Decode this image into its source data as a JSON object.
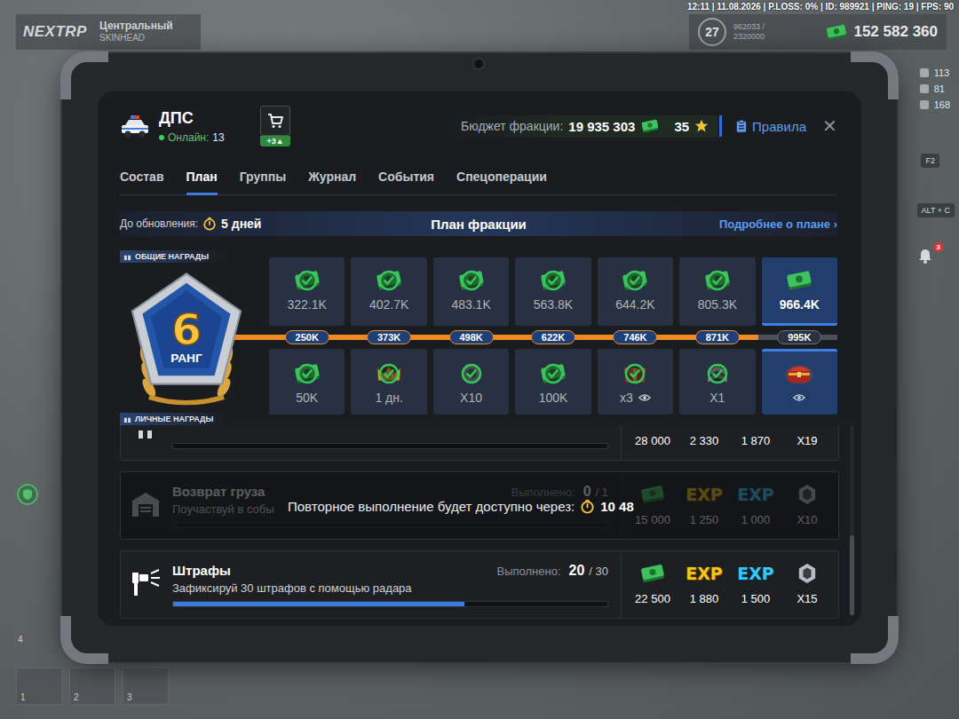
{
  "hud": {
    "status_line": "12:11 | 11.08.2026 | P.LOSS: 0% | ID: 989921 | PING: 19 | FPS: 90",
    "logo": "NEXTRP",
    "server": "Центральный",
    "player": "SKINHEAD",
    "level": "27",
    "xp": "962033 / 2320000",
    "money": "152 582 360",
    "stats": [
      "113",
      "81",
      "168"
    ],
    "hints": [
      "F2",
      "ALT + C"
    ],
    "notifications": "3",
    "hotbar": [
      "1",
      "2",
      "3"
    ],
    "extra_slot": "4"
  },
  "faction": {
    "name": "ДПС",
    "online_label": "Онлайн:",
    "online": "13",
    "shop_badge": "+3▲"
  },
  "budget": {
    "label": "Бюджет фракции:",
    "value": "19 935 303",
    "stars": "35"
  },
  "rules": "Правила",
  "close": "✕",
  "tabs": [
    {
      "label": "Состав",
      "selected": false
    },
    {
      "label": "План",
      "selected": true
    },
    {
      "label": "Группы",
      "selected": false
    },
    {
      "label": "Журнал",
      "selected": false
    },
    {
      "label": "События",
      "selected": false
    },
    {
      "label": "Спецоперации",
      "selected": false
    }
  ],
  "plan": {
    "update_label": "До обновления:",
    "update_time": "5 дней",
    "title": "План фракции",
    "more": "Подробнее о плане ›"
  },
  "rewards": {
    "common_label": "ОБЩИЕ НАГРАДЫ",
    "personal_label": "ЛИЧНЫЕ НАГРАДЫ",
    "rank": "6",
    "rank_label": "РАНГ",
    "track_level": 0.87,
    "tiers": [
      {
        "threshold": "250K",
        "reached": true,
        "current": false,
        "common": {
          "value": "322.1K",
          "claimed": true
        },
        "personal": {
          "kind": "money",
          "value": "50K",
          "claimed": true,
          "preview": false
        }
      },
      {
        "threshold": "373K",
        "reached": true,
        "current": false,
        "common": {
          "value": "402.7K",
          "claimed": true
        },
        "personal": {
          "kind": "crown",
          "value": "1 дн.",
          "claimed": true,
          "preview": false
        }
      },
      {
        "threshold": "498K",
        "reached": true,
        "current": false,
        "common": {
          "value": "483.1K",
          "claimed": true
        },
        "personal": {
          "kind": "badge",
          "value": "X10",
          "claimed": true,
          "preview": false
        }
      },
      {
        "threshold": "622K",
        "reached": true,
        "current": false,
        "common": {
          "value": "563.8K",
          "claimed": true
        },
        "personal": {
          "kind": "money",
          "value": "100K",
          "claimed": true,
          "preview": false
        }
      },
      {
        "threshold": "746K",
        "reached": true,
        "current": false,
        "common": {
          "value": "644.2K",
          "claimed": true
        },
        "personal": {
          "kind": "box",
          "value": "x3",
          "claimed": true,
          "preview": true
        }
      },
      {
        "threshold": "871K",
        "reached": true,
        "current": false,
        "common": {
          "value": "805.3K",
          "claimed": true
        },
        "personal": {
          "kind": "chevron",
          "value": "X1",
          "claimed": true,
          "preview": false
        }
      },
      {
        "threshold": "995K",
        "reached": false,
        "current": true,
        "common": {
          "value": "966.4K",
          "claimed": false
        },
        "personal": {
          "kind": "chest",
          "claimed": false,
          "preview": true
        }
      }
    ]
  },
  "tasks": [
    {
      "kind": "partial",
      "disabled": false,
      "level": 0,
      "rewards": [
        {
          "kind": "money",
          "value": "28 000"
        },
        {
          "kind": "exp",
          "value": "2 330"
        },
        {
          "kind": "exp2",
          "value": "1 870"
        },
        {
          "kind": "token",
          "value": "X19"
        }
      ]
    },
    {
      "kind": "cargo",
      "title": "Возврат груза",
      "description": "Поучаствуй в собы",
      "done_label": "Выполнено:",
      "done": "0",
      "total": "/ 1",
      "level": 0,
      "disabled": true,
      "cooldown": {
        "label": "Повторное выполнение будет доступно через:",
        "time": "10 48"
      },
      "rewards": [
        {
          "kind": "money",
          "value": "15 000"
        },
        {
          "kind": "exp",
          "label": "EXP",
          "value": "1 250"
        },
        {
          "kind": "exp2",
          "label": "EXP",
          "value": "1 000"
        },
        {
          "kind": "token",
          "value": "X10"
        }
      ]
    },
    {
      "kind": "radar",
      "title": "Штрафы",
      "description": "Зафиксируй 30 штрафов с помощью радара",
      "done_label": "Выполнено:",
      "done": "20",
      "total": "/ 30",
      "level": 0.67,
      "disabled": false,
      "rewards": [
        {
          "kind": "money",
          "value": "22 500"
        },
        {
          "kind": "exp",
          "label": "EXP",
          "value": "1 880"
        },
        {
          "kind": "exp2",
          "label": "EXP",
          "value": "1 500"
        },
        {
          "kind": "token",
          "value": "X15"
        }
      ]
    }
  ],
  "scrollbar": {
    "level": 1
  }
}
